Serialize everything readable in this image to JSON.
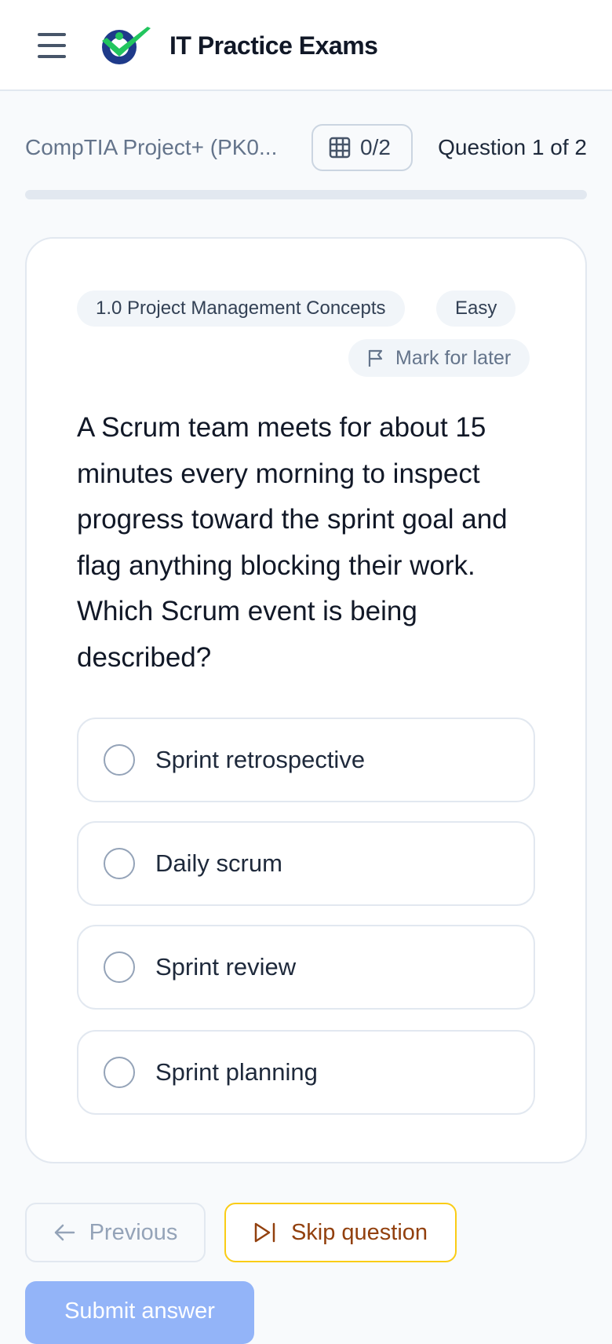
{
  "header": {
    "app_title": "IT Practice Exams",
    "menu_icon": "hamburger-menu-icon",
    "logo_icon": "checkmark-person-logo"
  },
  "exam": {
    "name": "CompTIA Project+ (PK0...",
    "counter": "0/2",
    "counter_icon": "grid-icon",
    "question_position": "Question 1 of 2",
    "progress_fraction": 0
  },
  "question": {
    "tags": [
      "1.0 Project Management Concepts",
      "Easy"
    ],
    "mark_label": "Mark for later",
    "mark_icon": "flag-icon",
    "text": "A Scrum team meets for about 15 minutes every morning to inspect progress toward the sprint goal and flag anything blocking their work. Which Scrum event is being described?",
    "options": [
      {
        "label": "Sprint retrospective"
      },
      {
        "label": "Daily scrum"
      },
      {
        "label": "Sprint review"
      },
      {
        "label": "Sprint planning"
      }
    ]
  },
  "actions": {
    "previous_label": "Previous",
    "previous_icon": "arrow-left-icon",
    "skip_label": "Skip question",
    "skip_icon": "skip-forward-icon",
    "submit_label": "Submit answer"
  },
  "colors": {
    "accent": "#3b82f6",
    "submit_disabled": "#93b4f8",
    "skip_border": "#facc15",
    "skip_text": "#92400e",
    "logo_green": "#22c55e",
    "logo_navy": "#1e3a8a"
  }
}
